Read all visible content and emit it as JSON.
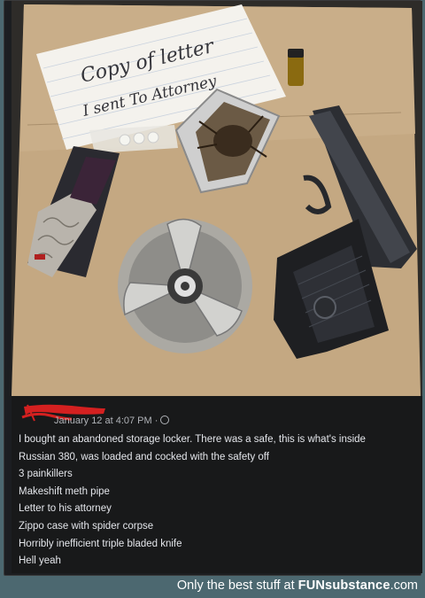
{
  "post": {
    "timestamp": "January 12 at 4:07 PM",
    "privacy_icon": "globe-icon",
    "lines": [
      "I bought an abandoned storage locker. There was a safe, this is what's inside",
      "Russian 380, was loaded and cocked with the safety off",
      "3 painkillers",
      "Makeshift meth pipe",
      "Letter to his attorney",
      "Zippo case with spider corpse",
      "Horribly inefficient triple bladed knife",
      "Hell yeah"
    ]
  },
  "photo": {
    "note_line1": "Copy of letter",
    "note_line2": "I sent To Attorney"
  },
  "footer": {
    "prefix": "Only the best stuff at ",
    "brand": "FUNsubstance",
    "suffix": ".com"
  },
  "colors": {
    "redaction": "#d42020",
    "card_background": "#18191a",
    "footer_background": "#4c6870",
    "text": "#e4e6eb"
  }
}
